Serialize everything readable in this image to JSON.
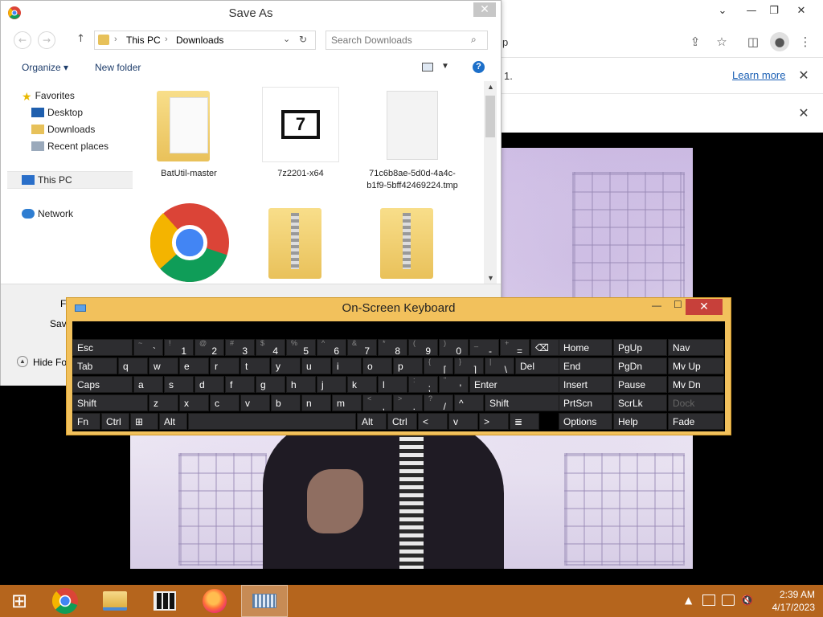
{
  "browser": {
    "url_fragment": "p",
    "infobar_text": "1.",
    "learn_more": "Learn more",
    "window_buttons": {
      "minimize": "⌄",
      "min": "—",
      "restore": "❐",
      "close": "✕"
    }
  },
  "save_dialog": {
    "title": "Save As",
    "close_glyph": "✕",
    "breadcrumb": [
      "This PC",
      "Downloads"
    ],
    "search_placeholder": "Search Downloads",
    "toolbar": {
      "organize": "Organize ▾",
      "new_folder": "New folder"
    },
    "sidebar": {
      "favorites": "Favorites",
      "desktop": "Desktop",
      "downloads": "Downloads",
      "recent": "Recent places",
      "this_pc": "This PC",
      "network": "Network"
    },
    "files": [
      {
        "name": "BatUtil-master",
        "type": "folder"
      },
      {
        "name": "7z2201-x64",
        "type": "installer"
      },
      {
        "name": "71c6b8ae-5d0d-4a4c-b1f9-5bff42469224.tmp",
        "type": "file"
      },
      {
        "name": "",
        "type": "chrome"
      },
      {
        "name": "",
        "type": "zip"
      },
      {
        "name": "",
        "type": "zip"
      }
    ],
    "bottom": {
      "filename_label": "Fi",
      "save_label": "Save",
      "hide_folders": "Hide Fo"
    }
  },
  "osk": {
    "title": "On-Screen Keyboard",
    "buttons": {
      "minimize": "—",
      "maximize": "☐",
      "close": "✕"
    },
    "rows": [
      [
        {
          "l": "Esc"
        },
        {
          "s": "~",
          "l": "`"
        },
        {
          "s": "!",
          "l": "1"
        },
        {
          "s": "@",
          "l": "2"
        },
        {
          "s": "#",
          "l": "3"
        },
        {
          "s": "$",
          "l": "4"
        },
        {
          "s": "%",
          "l": "5"
        },
        {
          "s": "^",
          "l": "6"
        },
        {
          "s": "&",
          "l": "7"
        },
        {
          "s": "*",
          "l": "8"
        },
        {
          "s": "(",
          "l": "9"
        },
        {
          "s": ")",
          "l": "0"
        },
        {
          "s": "_",
          "l": "-"
        },
        {
          "s": "+",
          "l": "="
        },
        {
          "l": "⌫"
        }
      ],
      [
        {
          "l": "Tab"
        },
        {
          "l": "q"
        },
        {
          "l": "w"
        },
        {
          "l": "e"
        },
        {
          "l": "r"
        },
        {
          "l": "t"
        },
        {
          "l": "y"
        },
        {
          "l": "u"
        },
        {
          "l": "i"
        },
        {
          "l": "o"
        },
        {
          "l": "p"
        },
        {
          "s": "{",
          "l": "["
        },
        {
          "s": "}",
          "l": "]"
        },
        {
          "s": "|",
          "l": "\\"
        },
        {
          "l": "Del"
        }
      ],
      [
        {
          "l": "Caps"
        },
        {
          "l": "a"
        },
        {
          "l": "s"
        },
        {
          "l": "d"
        },
        {
          "l": "f"
        },
        {
          "l": "g"
        },
        {
          "l": "h"
        },
        {
          "l": "j"
        },
        {
          "l": "k"
        },
        {
          "l": "l"
        },
        {
          "s": ":",
          "l": ";"
        },
        {
          "s": "\"",
          "l": "'"
        },
        {
          "l": "Enter"
        }
      ],
      [
        {
          "l": "Shift"
        },
        {
          "l": "z"
        },
        {
          "l": "x"
        },
        {
          "l": "c"
        },
        {
          "l": "v"
        },
        {
          "l": "b"
        },
        {
          "l": "n"
        },
        {
          "l": "m"
        },
        {
          "s": "<",
          "l": ","
        },
        {
          "s": ">",
          "l": "."
        },
        {
          "s": "?",
          "l": "/"
        },
        {
          "l": "^"
        },
        {
          "l": "Shift"
        }
      ],
      [
        {
          "l": "Fn"
        },
        {
          "l": "Ctrl"
        },
        {
          "l": "⊞"
        },
        {
          "l": "Alt"
        },
        {
          "l": ""
        },
        {
          "l": "Alt"
        },
        {
          "l": "Ctrl"
        },
        {
          "l": "<"
        },
        {
          "l": "v"
        },
        {
          "l": ">"
        },
        {
          "l": "≣"
        }
      ]
    ],
    "nav_keys": [
      [
        "Home",
        "PgUp",
        "Nav"
      ],
      [
        "End",
        "PgDn",
        "Mv Up"
      ],
      [
        "Insert",
        "Pause",
        "Mv Dn"
      ],
      [
        "PrtScn",
        "ScrLk",
        "Dock"
      ],
      [
        "Options",
        "Help",
        "Fade"
      ]
    ]
  },
  "taskbar": {
    "start_glyph": "⊞",
    "time": "2:39 AM",
    "date": "4/17/2023",
    "tray_caret": "▲"
  }
}
